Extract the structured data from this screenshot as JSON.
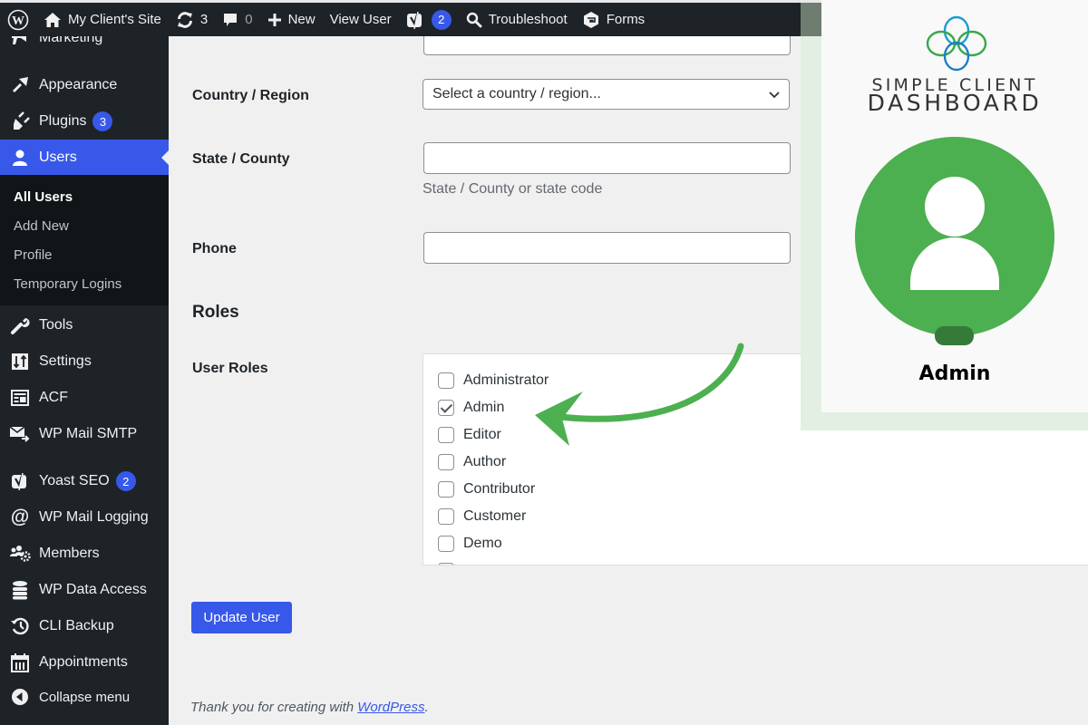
{
  "adminbar": {
    "site_name": "My Client's Site",
    "updates_count": "3",
    "comments_count": "0",
    "new_label": "New",
    "view_user_label": "View User",
    "yoast_badge": "2",
    "troubleshoot_label": "Troubleshoot",
    "forms_label": "Forms"
  },
  "sidebar": {
    "items": [
      {
        "label": "Marketing",
        "icon": "megaphone-icon"
      },
      {
        "label": "Appearance",
        "icon": "paintbrush-icon"
      },
      {
        "label": "Plugins",
        "icon": "plug-icon",
        "badge": "3"
      },
      {
        "label": "Users",
        "icon": "user-icon",
        "active": true
      },
      {
        "label": "Tools",
        "icon": "wrench-icon"
      },
      {
        "label": "Settings",
        "icon": "sliders-icon"
      },
      {
        "label": "ACF",
        "icon": "table-icon"
      },
      {
        "label": "WP Mail SMTP",
        "icon": "mail-arrow-icon"
      },
      {
        "label": "Yoast SEO",
        "icon": "yoast-icon",
        "badge": "2"
      },
      {
        "label": "WP Mail Logging",
        "icon": "at-icon"
      },
      {
        "label": "Members",
        "icon": "members-gear-icon"
      },
      {
        "label": "WP Data Access",
        "icon": "database-icon"
      },
      {
        "label": "CLI Backup",
        "icon": "history-icon"
      },
      {
        "label": "Appointments",
        "icon": "calendar-icon"
      },
      {
        "label": "Collapse menu",
        "icon": "collapse-icon"
      }
    ],
    "users_submenu": [
      {
        "label": "All Users",
        "current": true
      },
      {
        "label": "Add New"
      },
      {
        "label": "Profile"
      },
      {
        "label": "Temporary Logins"
      }
    ]
  },
  "form": {
    "country_label": "Country / Region",
    "country_value": "Select a country / region...",
    "state_label": "State / County",
    "state_value": "",
    "state_help": "State / County or state code",
    "phone_label": "Phone",
    "phone_value": "",
    "roles_heading": "Roles",
    "user_roles_label": "User Roles",
    "roles": [
      {
        "label": "Administrator",
        "checked": false
      },
      {
        "label": "Admin",
        "checked": true
      },
      {
        "label": "Editor",
        "checked": false
      },
      {
        "label": "Author",
        "checked": false
      },
      {
        "label": "Contributor",
        "checked": false
      },
      {
        "label": "Customer",
        "checked": false
      },
      {
        "label": "Demo",
        "checked": false
      }
    ],
    "submit_label": "Update User"
  },
  "footer": {
    "text": "Thank you for creating with ",
    "link": "WordPress",
    "suffix": "."
  },
  "brand": {
    "line1": "SIMPLE CLIENT",
    "line2": "DASHBOARD",
    "role_name": "Admin"
  },
  "colors": {
    "accent": "#3858e9",
    "sidebar_bg": "#1d2327",
    "brand_green": "#4caf50",
    "status_dark_green": "#357a38"
  }
}
